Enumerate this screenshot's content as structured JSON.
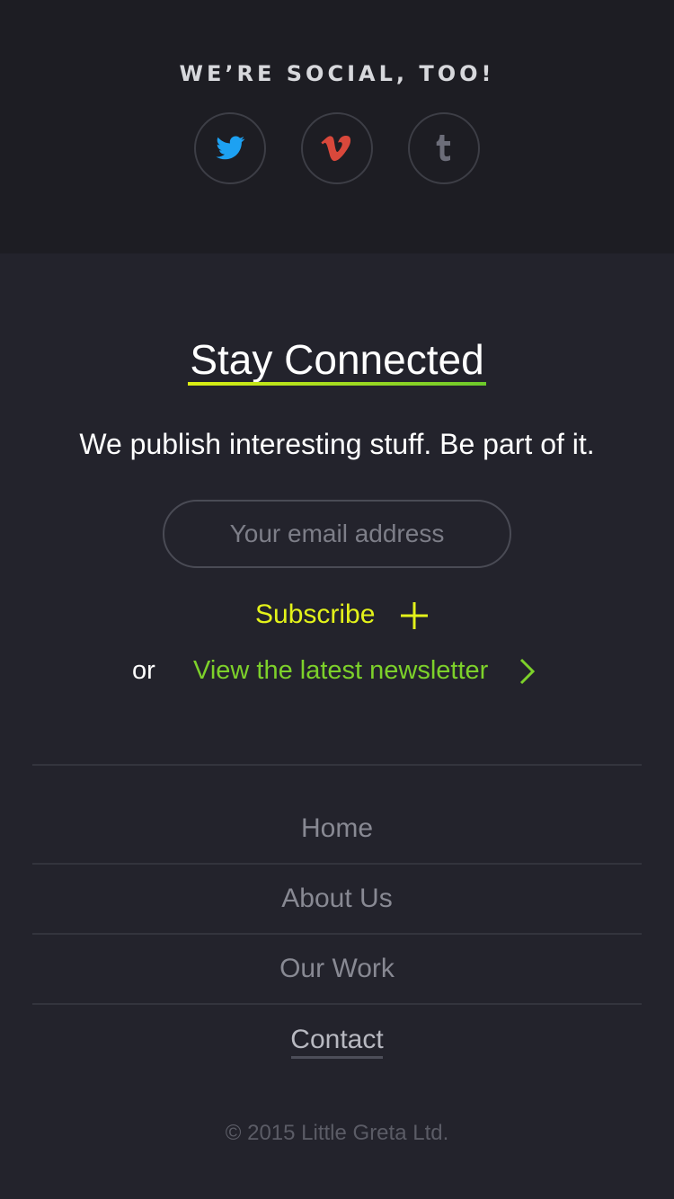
{
  "social": {
    "title": "WE’RE SOCIAL, TOO!",
    "links": [
      {
        "icon": "twitter-icon",
        "color": "#1da1f2"
      },
      {
        "icon": "vimeo-icon",
        "color": "#d9483b"
      },
      {
        "icon": "tumblr-icon",
        "color": "#6c6d79"
      }
    ]
  },
  "newsletter": {
    "heading": "Stay Connected",
    "tagline": "We publish interesting stuff. Be part of it.",
    "email_placeholder": "Your email address",
    "email_value": "",
    "subscribe_label": "Subscribe",
    "or_label": "or",
    "latest_label": "View the latest newsletter",
    "accent_yellow": "#e3f21a",
    "accent_green": "#7dd12a"
  },
  "footer_nav": {
    "items": [
      {
        "label": "Home"
      },
      {
        "label": "About Us"
      },
      {
        "label": "Our Work"
      },
      {
        "label": "Contact"
      }
    ],
    "active": "Contact"
  },
  "copyright": "© 2015 Little Greta Ltd."
}
